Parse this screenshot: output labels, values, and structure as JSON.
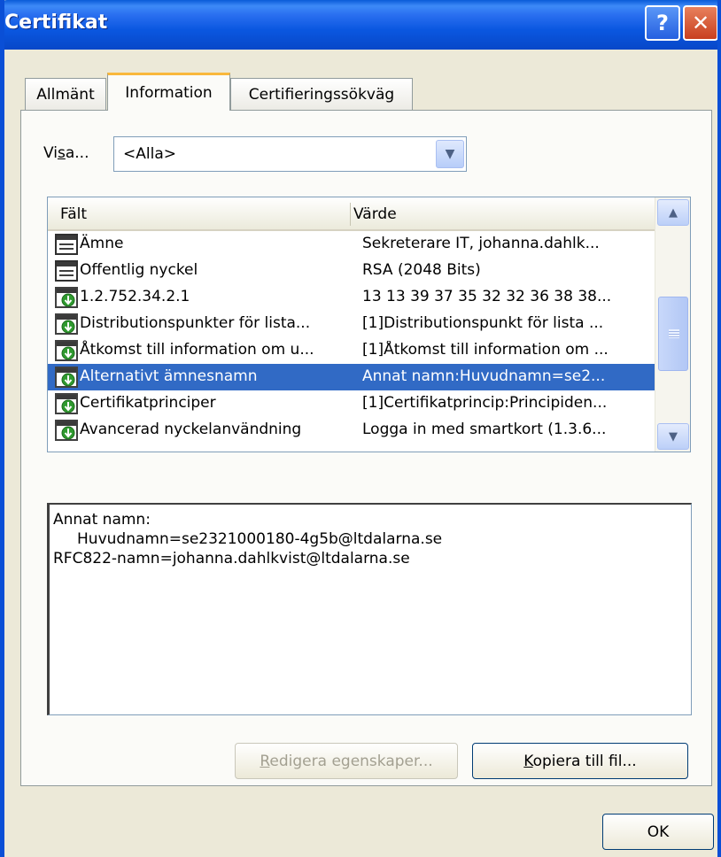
{
  "window": {
    "title": "Certifikat",
    "help_label": "?",
    "close_label": "✕"
  },
  "tabs": [
    {
      "label": "Allmänt"
    },
    {
      "label": "Information"
    },
    {
      "label": "Certifieringssökväg"
    }
  ],
  "show": {
    "label": "Visa...",
    "selected": "<Alla>"
  },
  "list": {
    "header_field": "Fält",
    "header_value": "Värde",
    "rows": [
      {
        "field": "Ämne",
        "value": "Sekreterare IT, johanna.dahlk...",
        "icon": "standard-field-icon"
      },
      {
        "field": "Offentlig nyckel",
        "value": "RSA (2048 Bits)",
        "icon": "standard-field-icon"
      },
      {
        "field": "1.2.752.34.2.1",
        "value": "13 13 39 37 35 32 32 36 38 38...",
        "icon": "extension-icon"
      },
      {
        "field": "Distributionspunkter för lista...",
        "value": "[1]Distributionspunkt för lista ...",
        "icon": "extension-icon"
      },
      {
        "field": "Åtkomst till information om u...",
        "value": "[1]Åtkomst till information om ...",
        "icon": "extension-icon"
      },
      {
        "field": "Alternativt ämnesnamn",
        "value": "Annat namn:Huvudnamn=se2...",
        "icon": "extension-icon",
        "selected": true
      },
      {
        "field": "Certifikatprinciper",
        "value": "[1]Certifikatprincip:Principiden...",
        "icon": "extension-icon"
      },
      {
        "field": "Avancerad nyckelanvändning",
        "value": "Logga in med smartkort (1.3.6...",
        "icon": "extension-icon"
      }
    ]
  },
  "detail": {
    "text": "Annat namn:\n     Huvudnamn=se2321000180-4g5b@ltdalarna.se\nRFC822-namn=johanna.dahlkvist@ltdalarna.se"
  },
  "buttons": {
    "edit_properties": "Redigera egenskaper...",
    "copy_to_file": "Kopiera till fil...",
    "ok": "OK"
  },
  "colors": {
    "titlebar": "#0a57e0",
    "dialog_bg": "#ece9d8",
    "selection": "#316ac5",
    "active_tab_accent": "#f9b83c"
  }
}
